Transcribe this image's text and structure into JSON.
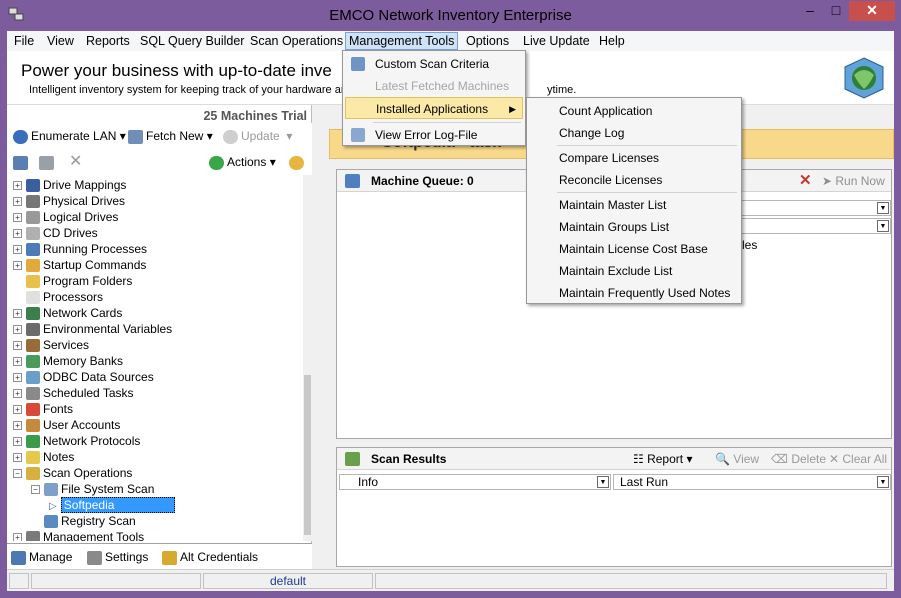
{
  "window": {
    "title": "EMCO Network Inventory Enterprise"
  },
  "menubar": [
    "File",
    "View",
    "Reports",
    "SQL Query Builder",
    "Scan Operations",
    "Management Tools",
    "Options",
    "Live Update",
    "Help"
  ],
  "banner": {
    "headline": "Power your business with up-to-date inve",
    "subtitle": "Intelligent inventory system for keeping track of your hardware and",
    "subtitle_tail": "ytime."
  },
  "left": {
    "trial": "25 Machines Trial",
    "toolbar1": {
      "enumerate": "Enumerate LAN",
      "fetch": "Fetch New",
      "update": "Update"
    },
    "toolbar2": {
      "actions": "Actions"
    },
    "tree": [
      "Drive Mappings",
      "Physical Drives",
      "Logical Drives",
      "CD Drives",
      "Running Processes",
      "Startup Commands",
      "Program Folders",
      "Processors",
      "Network Cards",
      "Environmental Variables",
      "Services",
      "Memory Banks",
      "ODBC Data Sources",
      "Scheduled Tasks",
      "Fonts",
      "User Accounts",
      "Network Protocols",
      "Notes",
      "Scan Operations",
      "File System Scan",
      "Softpedia",
      "Registry Scan",
      "Management Tools"
    ],
    "tabs": [
      "Manage",
      "Settings",
      "Alt Credentials"
    ]
  },
  "right": {
    "header_title": "Softpedia - task",
    "queue_label": "Machine Queue: 0",
    "run_now": "Run Now",
    "files_fragment": "a Files",
    "results_label": "Scan Results",
    "report": "Report",
    "view": "View",
    "delete": "Delete",
    "clear_all": "Clear All",
    "col_info": "Info",
    "col_lastrun": "Last Run"
  },
  "status": {
    "profile": "default"
  },
  "management_menu": {
    "items": [
      "Custom Scan Criteria",
      "Latest Fetched Machines",
      "Installed Applications",
      "View Error Log-File"
    ]
  },
  "installed_submenu": {
    "items": [
      "Count Application",
      "Change Log",
      "Compare Licenses",
      "Reconcile Licenses",
      "Maintain Master List",
      "Maintain Groups List",
      "Maintain License Cost Base",
      "Maintain Exclude List",
      "Maintain Frequently Used Notes"
    ]
  },
  "colors": {
    "accent": "#3399ff",
    "titlebar": "#7d5c9e",
    "highlight": "#fbe9a8",
    "close": "#c7504c"
  }
}
